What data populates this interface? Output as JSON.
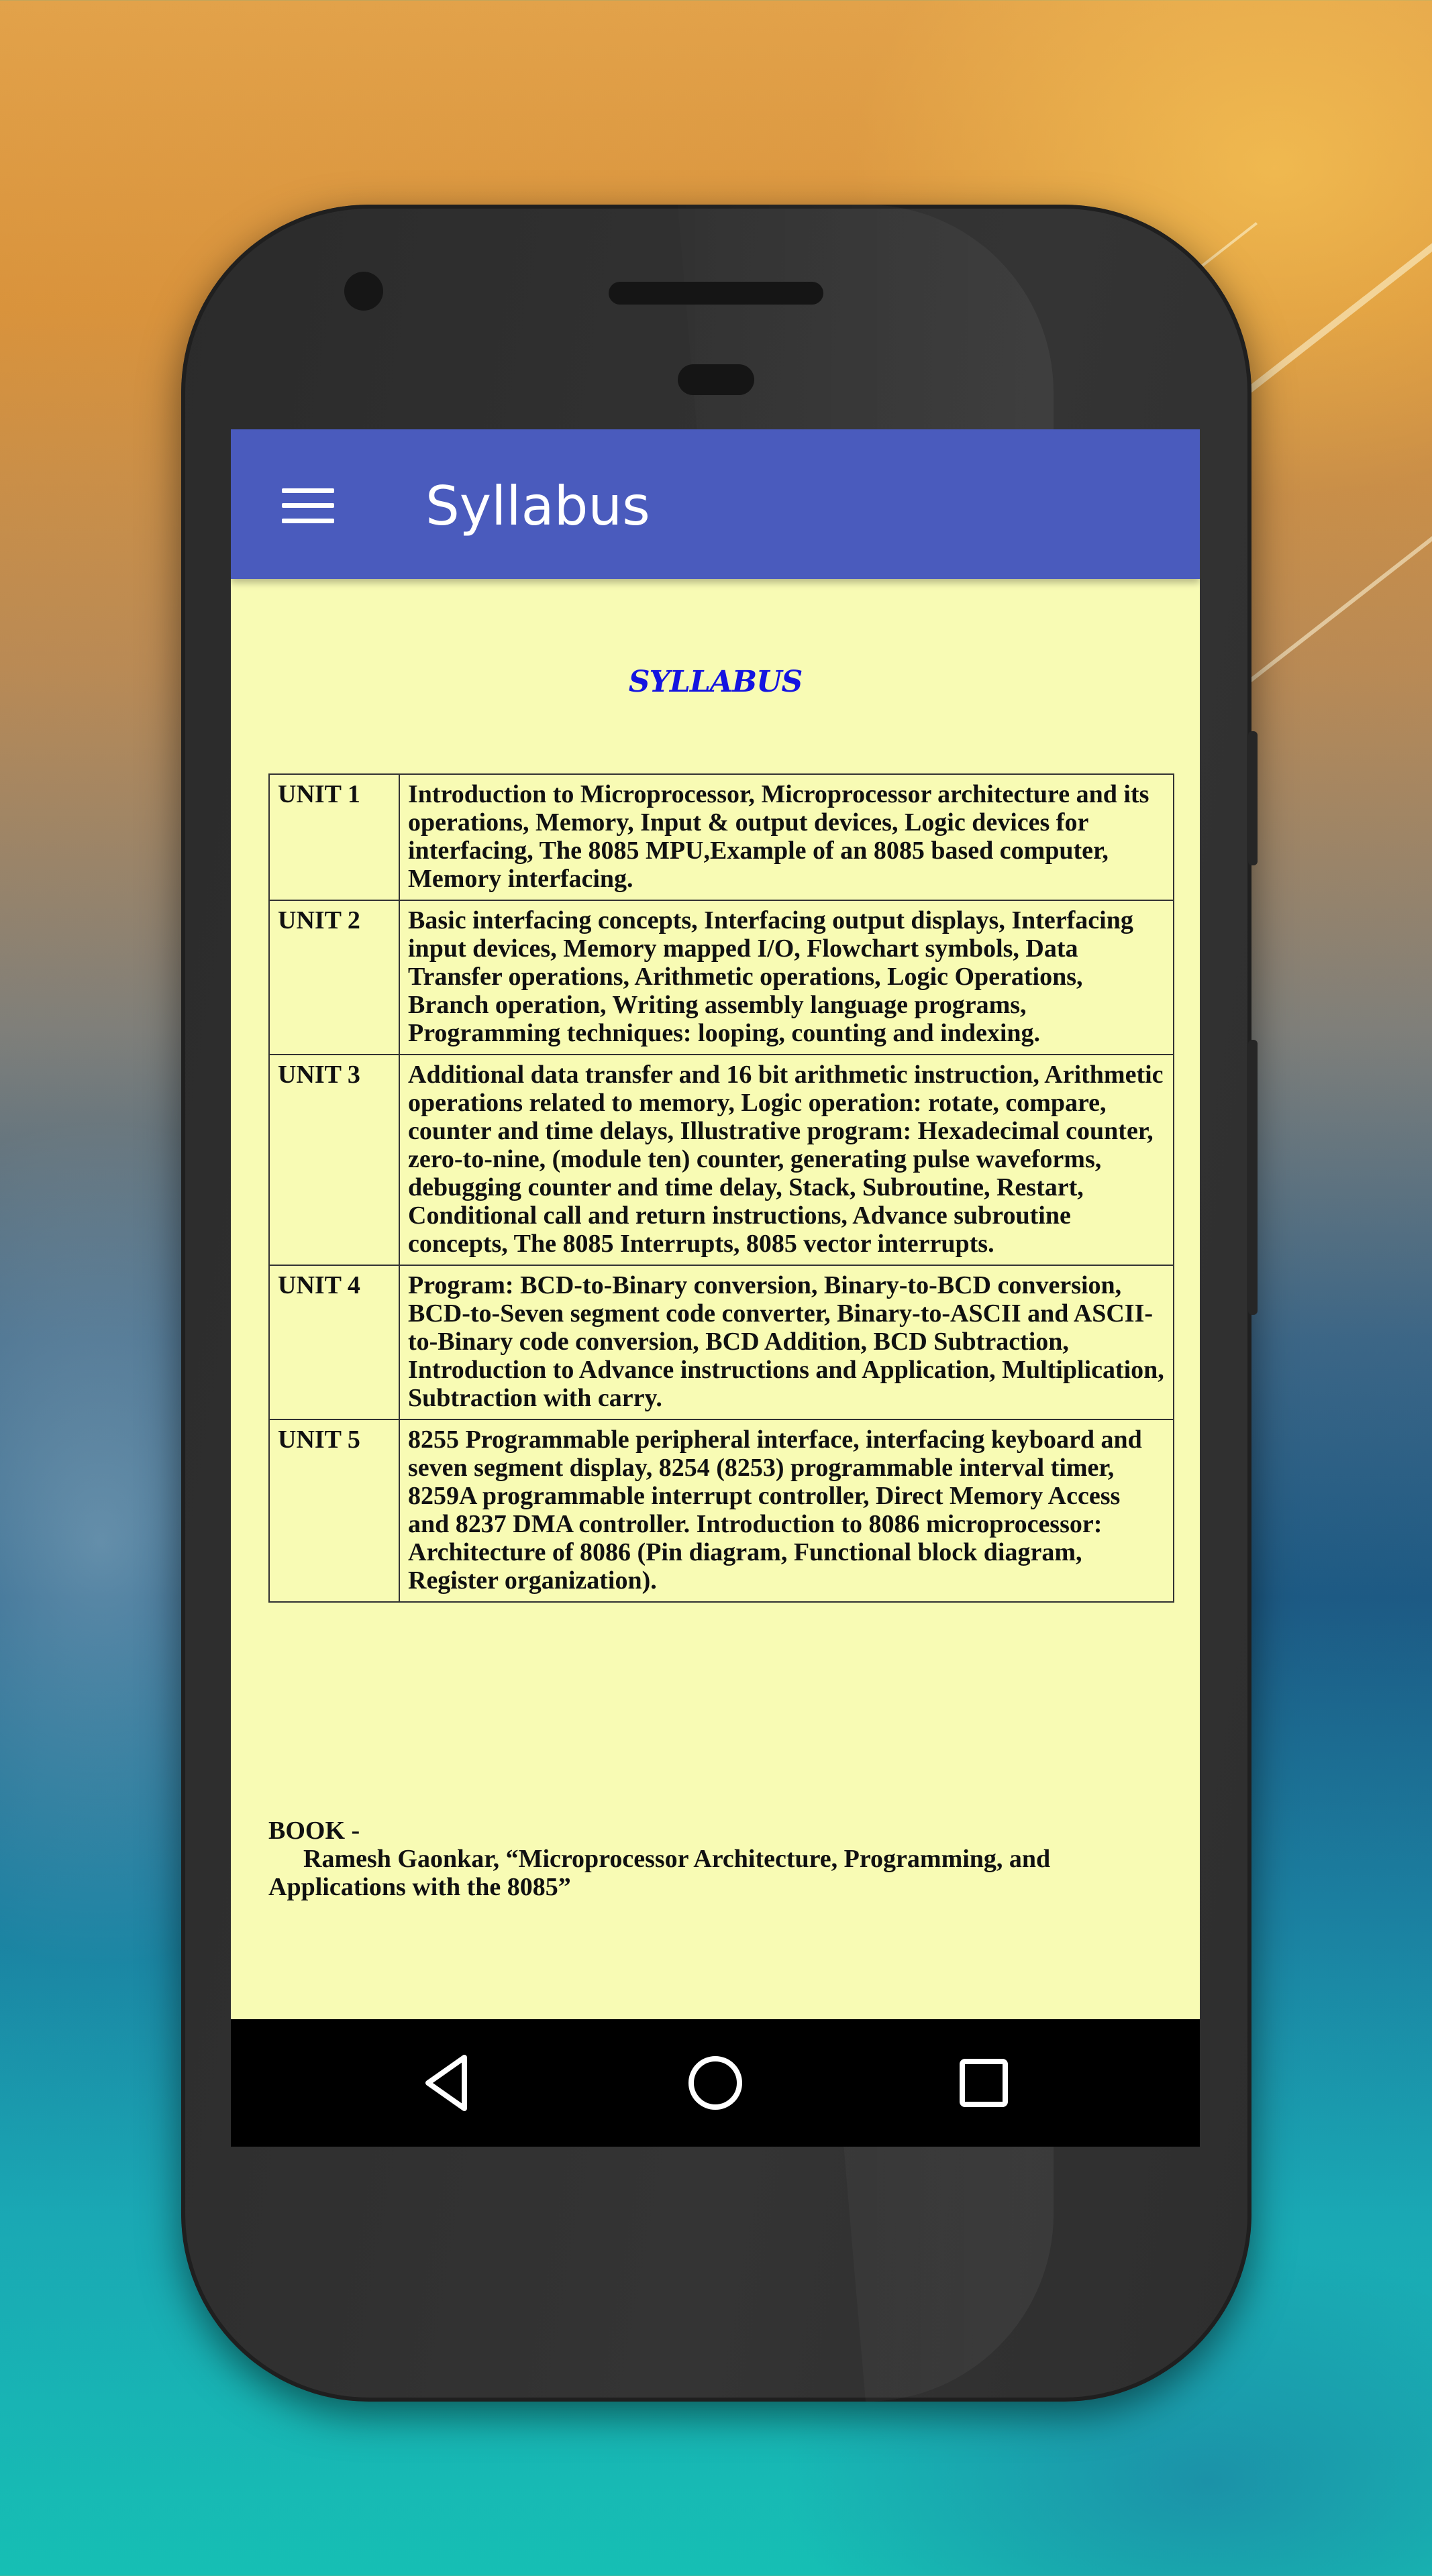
{
  "app_bar": {
    "title": "Syllabus",
    "background_color": "#4a5bbd"
  },
  "document": {
    "heading": "SYLLABUS",
    "heading_color": "#1414e0",
    "background_color": "#f8fbb4",
    "units": [
      {
        "unit": "UNIT 1",
        "description": "Introduction to Microprocessor, Microprocessor architecture and its operations, Memory, Input & output devices, Logic devices for interfacing, The 8085 MPU,Example of an 8085 based computer, Memory interfacing."
      },
      {
        "unit": "UNIT 2",
        "description": "Basic interfacing concepts, Interfacing output displays, Interfacing input devices, Memory mapped I/O, Flowchart symbols, Data Transfer operations, Arithmetic operations, Logic Operations, Branch operation, Writing assembly language programs, Programming techniques: looping, counting and indexing."
      },
      {
        "unit": "UNIT 3",
        "description": "Additional data transfer and 16 bit arithmetic instruction, Arithmetic operations related to memory, Logic operation: rotate, compare, counter and time delays, Illustrative program: Hexadecimal counter, zero-to-nine, (module ten) counter, generating pulse waveforms, debugging counter and time delay, Stack, Subroutine, Restart, Conditional call and return instructions, Advance subroutine concepts, The 8085 Interrupts, 8085 vector interrupts."
      },
      {
        "unit": "UNIT 4",
        "description": "Program: BCD-to-Binary conversion, Binary-to-BCD conversion, BCD-to-Seven segment code converter, Binary-to-ASCII and ASCII-to-Binary code conversion, BCD Addition, BCD Subtraction, Introduction to Advance instructions and Application, Multiplication, Subtraction with carry."
      },
      {
        "unit": "UNIT 5",
        "description": "8255 Programmable peripheral interface, interfacing keyboard and seven segment display, 8254 (8253) programmable interval timer, 8259A programmable interrupt controller, Direct Memory Access and 8237 DMA controller. Introduction to 8086 microprocessor: Architecture of 8086 (Pin diagram, Functional block diagram, Register organization)."
      }
    ],
    "book": {
      "label": "BOOK -",
      "line1": "Ramesh Gaonkar, “Microprocessor Architecture, Programming, and",
      "line2": "Applications with the 8085”"
    }
  },
  "nav_bar": {
    "back_icon": "triangle-back-icon",
    "home_icon": "circle-home-icon",
    "recents_icon": "square-recents-icon"
  }
}
